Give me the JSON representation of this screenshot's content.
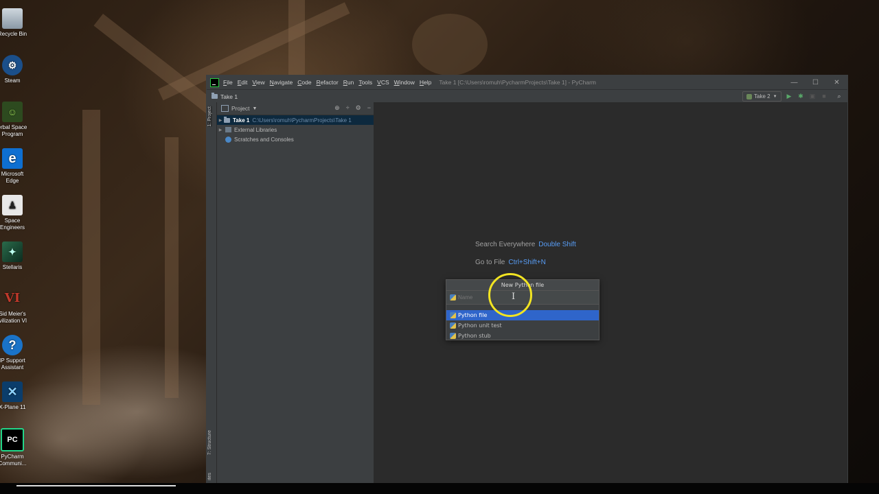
{
  "desktop": {
    "icons": [
      {
        "label": "Recycle Bin",
        "icon": "recycle-bin-icon"
      },
      {
        "label": "Steam",
        "icon": "steam-icon"
      },
      {
        "label": "erbal Space Program",
        "icon": "kerbal-space-program-icon"
      },
      {
        "label": "Microsoft Edge",
        "icon": "edge-icon"
      },
      {
        "label": "Space Engineers",
        "icon": "space-engineers-icon"
      },
      {
        "label": "Stellaris",
        "icon": "stellaris-icon"
      },
      {
        "label": "Sid Meier's ivilization VI",
        "icon": "civilization-icon"
      },
      {
        "label": "IP Support Assistant",
        "icon": "help-icon"
      },
      {
        "label": "X-Plane 11",
        "icon": "x-plane-icon"
      },
      {
        "label": "PyCharm Communi...",
        "icon": "pycharm-icon"
      }
    ]
  },
  "ide": {
    "menu": [
      "File",
      "Edit",
      "View",
      "Navigate",
      "Code",
      "Refactor",
      "Run",
      "Tools",
      "VCS",
      "Window",
      "Help"
    ],
    "window_title": "Take 1 [C:\\Users\\romuh\\PycharmProjects\\Take 1] - PyCharm",
    "breadcrumb": "Take 1",
    "run_config": "Take 2",
    "left_tabs": {
      "project": "1: Project",
      "structure": "7: Structure",
      "favorites": "ites"
    },
    "project_pane": {
      "title": "Project",
      "tree": [
        {
          "name": "Take 1",
          "path": "C:\\Users\\romuh\\PycharmProjects\\Take 1"
        },
        {
          "name": "External Libraries"
        },
        {
          "name": "Scratches and Consoles"
        }
      ]
    },
    "editor_hints": [
      {
        "text": "Search Everywhere",
        "key": "Double Shift"
      },
      {
        "text": "Go to File",
        "key": "Ctrl+Shift+N"
      }
    ],
    "popup": {
      "title": "New Python file",
      "placeholder": "Name",
      "options": [
        "Python file",
        "Python unit test",
        "Python stub"
      ],
      "selected_index": 0
    }
  },
  "colors": {
    "accent_blue": "#589df6",
    "selection": "#2f65ca",
    "cursor_ring": "#f2e422"
  }
}
